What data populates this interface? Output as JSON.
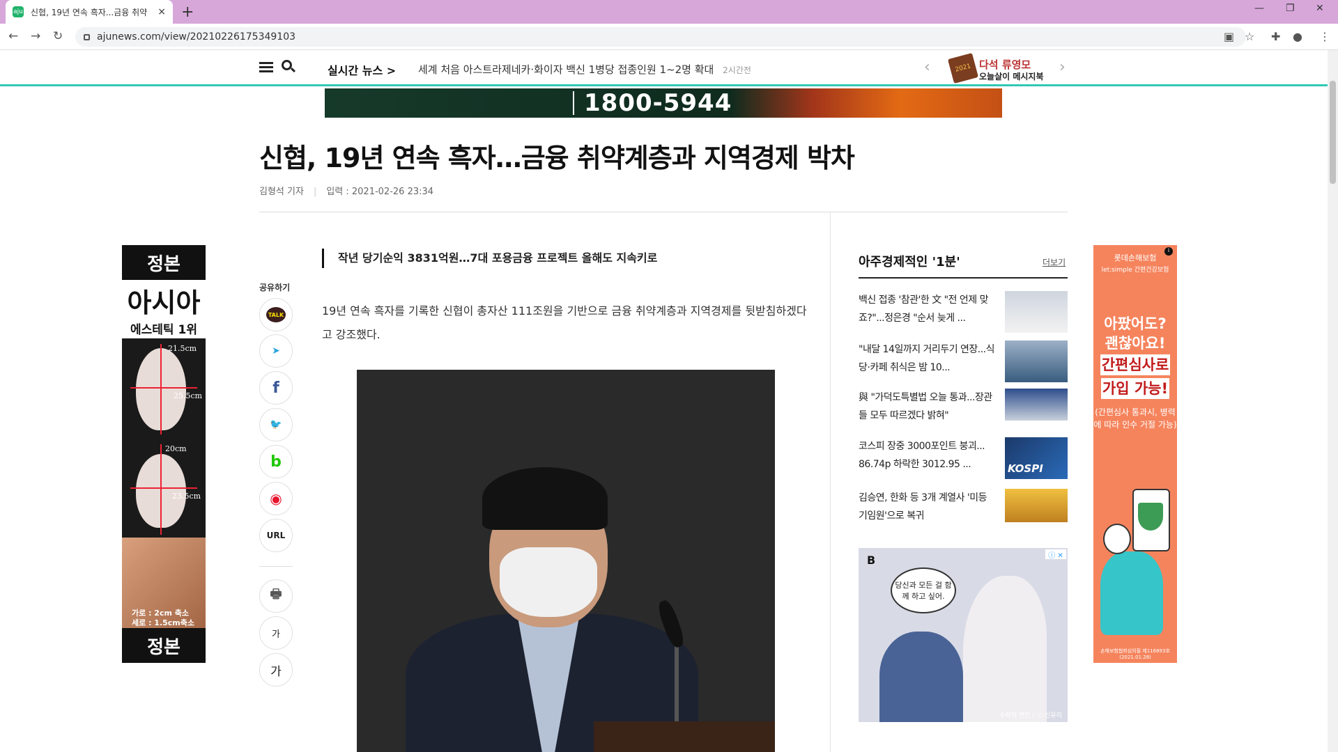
{
  "browser": {
    "tab_title": "신협, 19년 연속 흑자...금융 취약",
    "tab_favicon": "aju",
    "url": "ajunews.com/view/20210226175349103",
    "new_tab": "+",
    "close_tab": "×"
  },
  "header": {
    "realtime_label": "실시간 뉴스 >",
    "realtime_headline": "세계 처음 아스트라제네카·화이자 백신 1병당 접종인원 1~2명 확대",
    "realtime_time": "2시간전",
    "book_title": "다석 류영모",
    "book_subtitle": "오늘살이 메시지북",
    "book_badge": "2021"
  },
  "banner": {
    "phone": "1800-5944"
  },
  "article": {
    "title": "신협, 19년 연속 흑자…금융 취약계층과 지역경제 박차",
    "reporter": "김형석 기자",
    "date": "입력 : 2021-02-26 23:34",
    "subhead": "작년 당기순익 3831억원…7대 포용금융 프로젝트 올해도 지속키로",
    "paragraph": "19년 연속 흑자를 기록한 신협이 총자산 111조원을 기반으로 금융 취약계층과 지역경제를 뒷받침하겠다고 강조했다."
  },
  "share": {
    "label": "공유하기",
    "kakao": "TALK",
    "telegram": "➤",
    "facebook": "f",
    "twitter": "🐦",
    "band": "b",
    "weibo": "◉",
    "url": "URL",
    "print": "🖶",
    "font_small": "가",
    "font_large": "가"
  },
  "left_ad": {
    "brand": "정본",
    "headline": "아시아",
    "subline": "에스테틱 1위",
    "measure1": "21.5cm",
    "measure2": "25.5cm",
    "measure3": "20cm",
    "measure4": "23.5cm",
    "note1": "가로 : 2cm 축소",
    "note2": "세로 : 1.5cm축소"
  },
  "sidebar": {
    "title": "아주경제적인 '1분'",
    "more": "더보기",
    "items": [
      {
        "text": "백신 접종 '참관'한 文 \"전 언제 맞죠?\"...정은경 \"순서 늦게 ..."
      },
      {
        "text": "\"내달 14일까지 거리두기 연장...식당·카페 취식은 밤 10..."
      },
      {
        "text": "與 \"가덕도특별법 오늘 통과...장관들 모두 따르겠다 밝혀\""
      },
      {
        "text": "코스피 장중 3000포인트 붕괴... 86.74p 하락한 3012.95 ...",
        "thumb_text": "KOSPI"
      },
      {
        "text": "김승연, 한화 등 3개 계열사 '미등기임원'으로 복귀"
      }
    ]
  },
  "right_ad": {
    "speech": "당신과 모든 걸 함께 하고 싶어.",
    "caption": "수라의 연인 / ⓒ 신유리",
    "logo": "B",
    "adchoice": "ⓘ ✕"
  },
  "skyscraper": {
    "brand": "롯데손해보험",
    "brand_sub": "let:simple 간편건강보험",
    "q1": "아팠어도?",
    "q2": "괜찮아요!",
    "h1": "간편심사로",
    "h2": "가입 가능!",
    "small": "(간편심사 통과시, 병력에 따라 인수 거절 가능)",
    "tiny": "손해보험협회심의필 제116893호(2021.01.28)"
  }
}
